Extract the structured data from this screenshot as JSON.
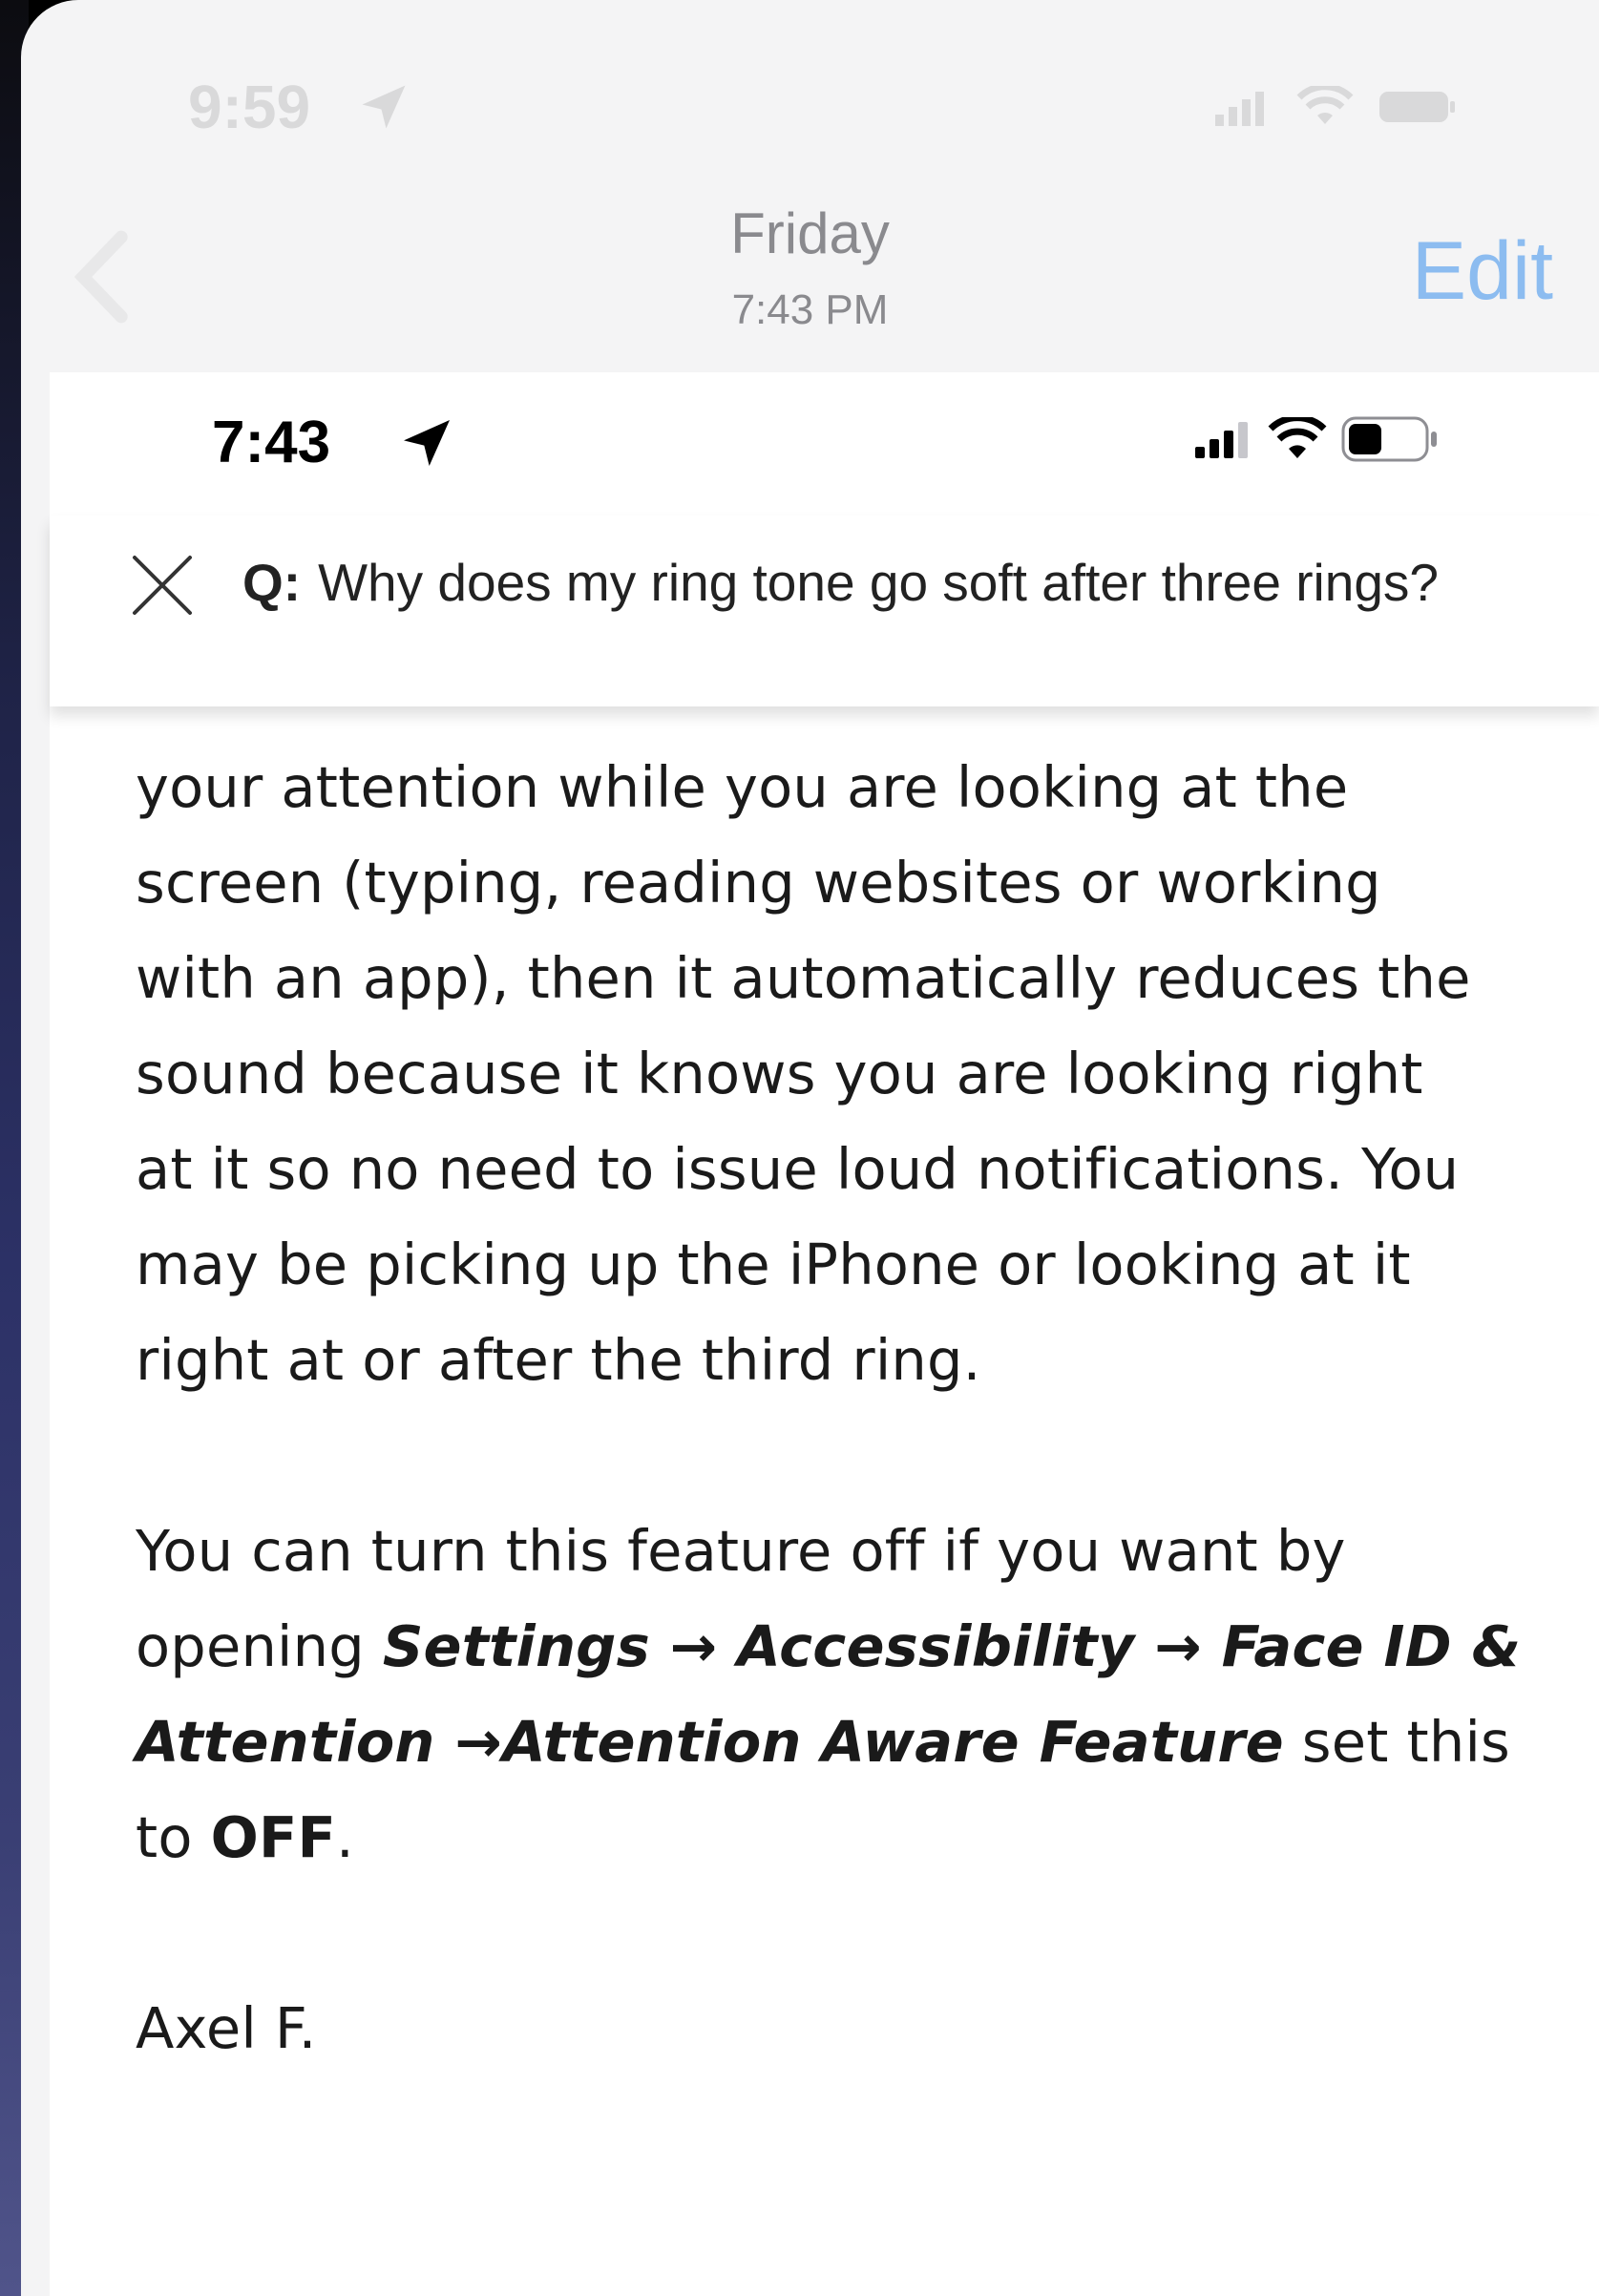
{
  "outer": {
    "status_time": "9:59",
    "nav_day": "Friday",
    "nav_time": "7:43 PM",
    "edit_label": "Edit"
  },
  "inner": {
    "status_time": "7:43",
    "question_prefix": "Q:",
    "question": "Why does my ring tone go soft after three rings?"
  },
  "answer": {
    "line1": "your attention while you are looking at the",
    "line2": "screen (typing, reading websites or working",
    "line3": "with an app), then it automatically reduces the",
    "line4": "sound because it knows you are looking right",
    "line5": "at it so no need to issue loud notifications. You",
    "line6": "may be picking up the iPhone or looking at it",
    "line7": "right at or after the third ring.",
    "p2_line1": "You can turn this feature off if you want by",
    "p2_opening": "opening ",
    "p2_settings": "Settings",
    "p2_arrow1": " → ",
    "p2_accessibility": "Accessibility",
    "p2_arrow2": " → ",
    "p2_faceid": "Face ID &",
    "p2_attention": "Attention",
    "p2_arrow3": " →",
    "p2_feature": "Attention Aware Feature",
    "p2_setthis": " set this",
    "p2_to": "to ",
    "p2_off": "OFF",
    "p2_period": ".",
    "signature": "Axel F."
  },
  "colors": {
    "edit": "#8cbcf0",
    "background": "#f4f4f5",
    "card": "#ffffff"
  },
  "icons": [
    "location-arrow-icon",
    "cellular-signal-icon",
    "wifi-icon",
    "battery-icon",
    "close-icon",
    "back-chevron-icon"
  ]
}
